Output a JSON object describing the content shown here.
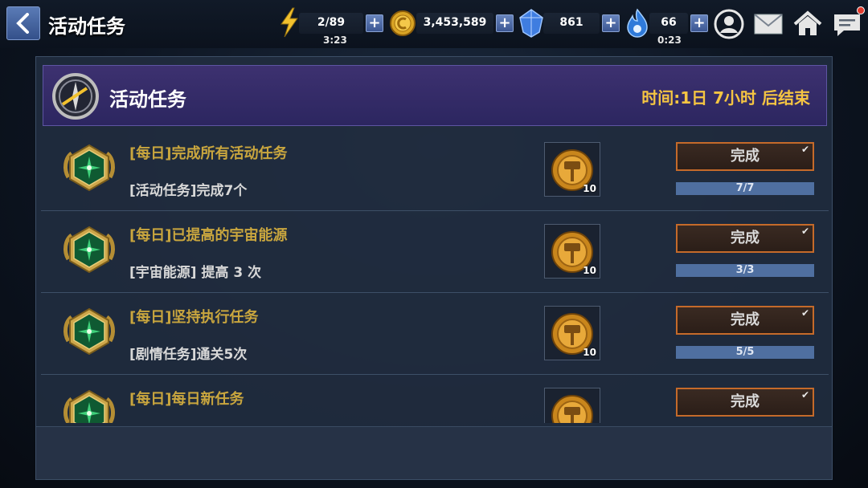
{
  "screen": {
    "title": "活动任务"
  },
  "resources": {
    "energy": {
      "value": "2/89",
      "timer": "3:23",
      "icon": "lightning-icon"
    },
    "gold": {
      "value": "3,453,589",
      "icon": "gold-coin-icon"
    },
    "crystal": {
      "value": "861",
      "icon": "blue-crystal-icon"
    },
    "stamina": {
      "value": "66",
      "timer": "0:23",
      "icon": "blue-flame-icon"
    },
    "plus_label": "+"
  },
  "panel": {
    "title": "活动任务",
    "time_left": "时间:1日 7小时 后结束"
  },
  "tasks": [
    {
      "title": "[每日]完成所有活动任务",
      "desc": "[活动任务]完成7个",
      "reward_qty": "10",
      "button": "完成",
      "progress": "7/7",
      "fraction": 1.0
    },
    {
      "title": "[每日]已提高的宇宙能源",
      "desc": "[宇宙能源] 提高 3 次",
      "reward_qty": "10",
      "button": "完成",
      "progress": "3/3",
      "fraction": 1.0
    },
    {
      "title": "[每日]坚持执行任务",
      "desc": "[剧情任务]通关5次",
      "reward_qty": "10",
      "button": "完成",
      "progress": "5/5",
      "fraction": 1.0
    },
    {
      "title": "[每日]每日新任务",
      "desc": "",
      "reward_qty": "",
      "button": "完成",
      "progress": "",
      "fraction": 1.0
    }
  ],
  "colors": {
    "accent_gold": "#f5c542",
    "button_border": "#c56a2a",
    "header_bg": "#3d3170"
  }
}
